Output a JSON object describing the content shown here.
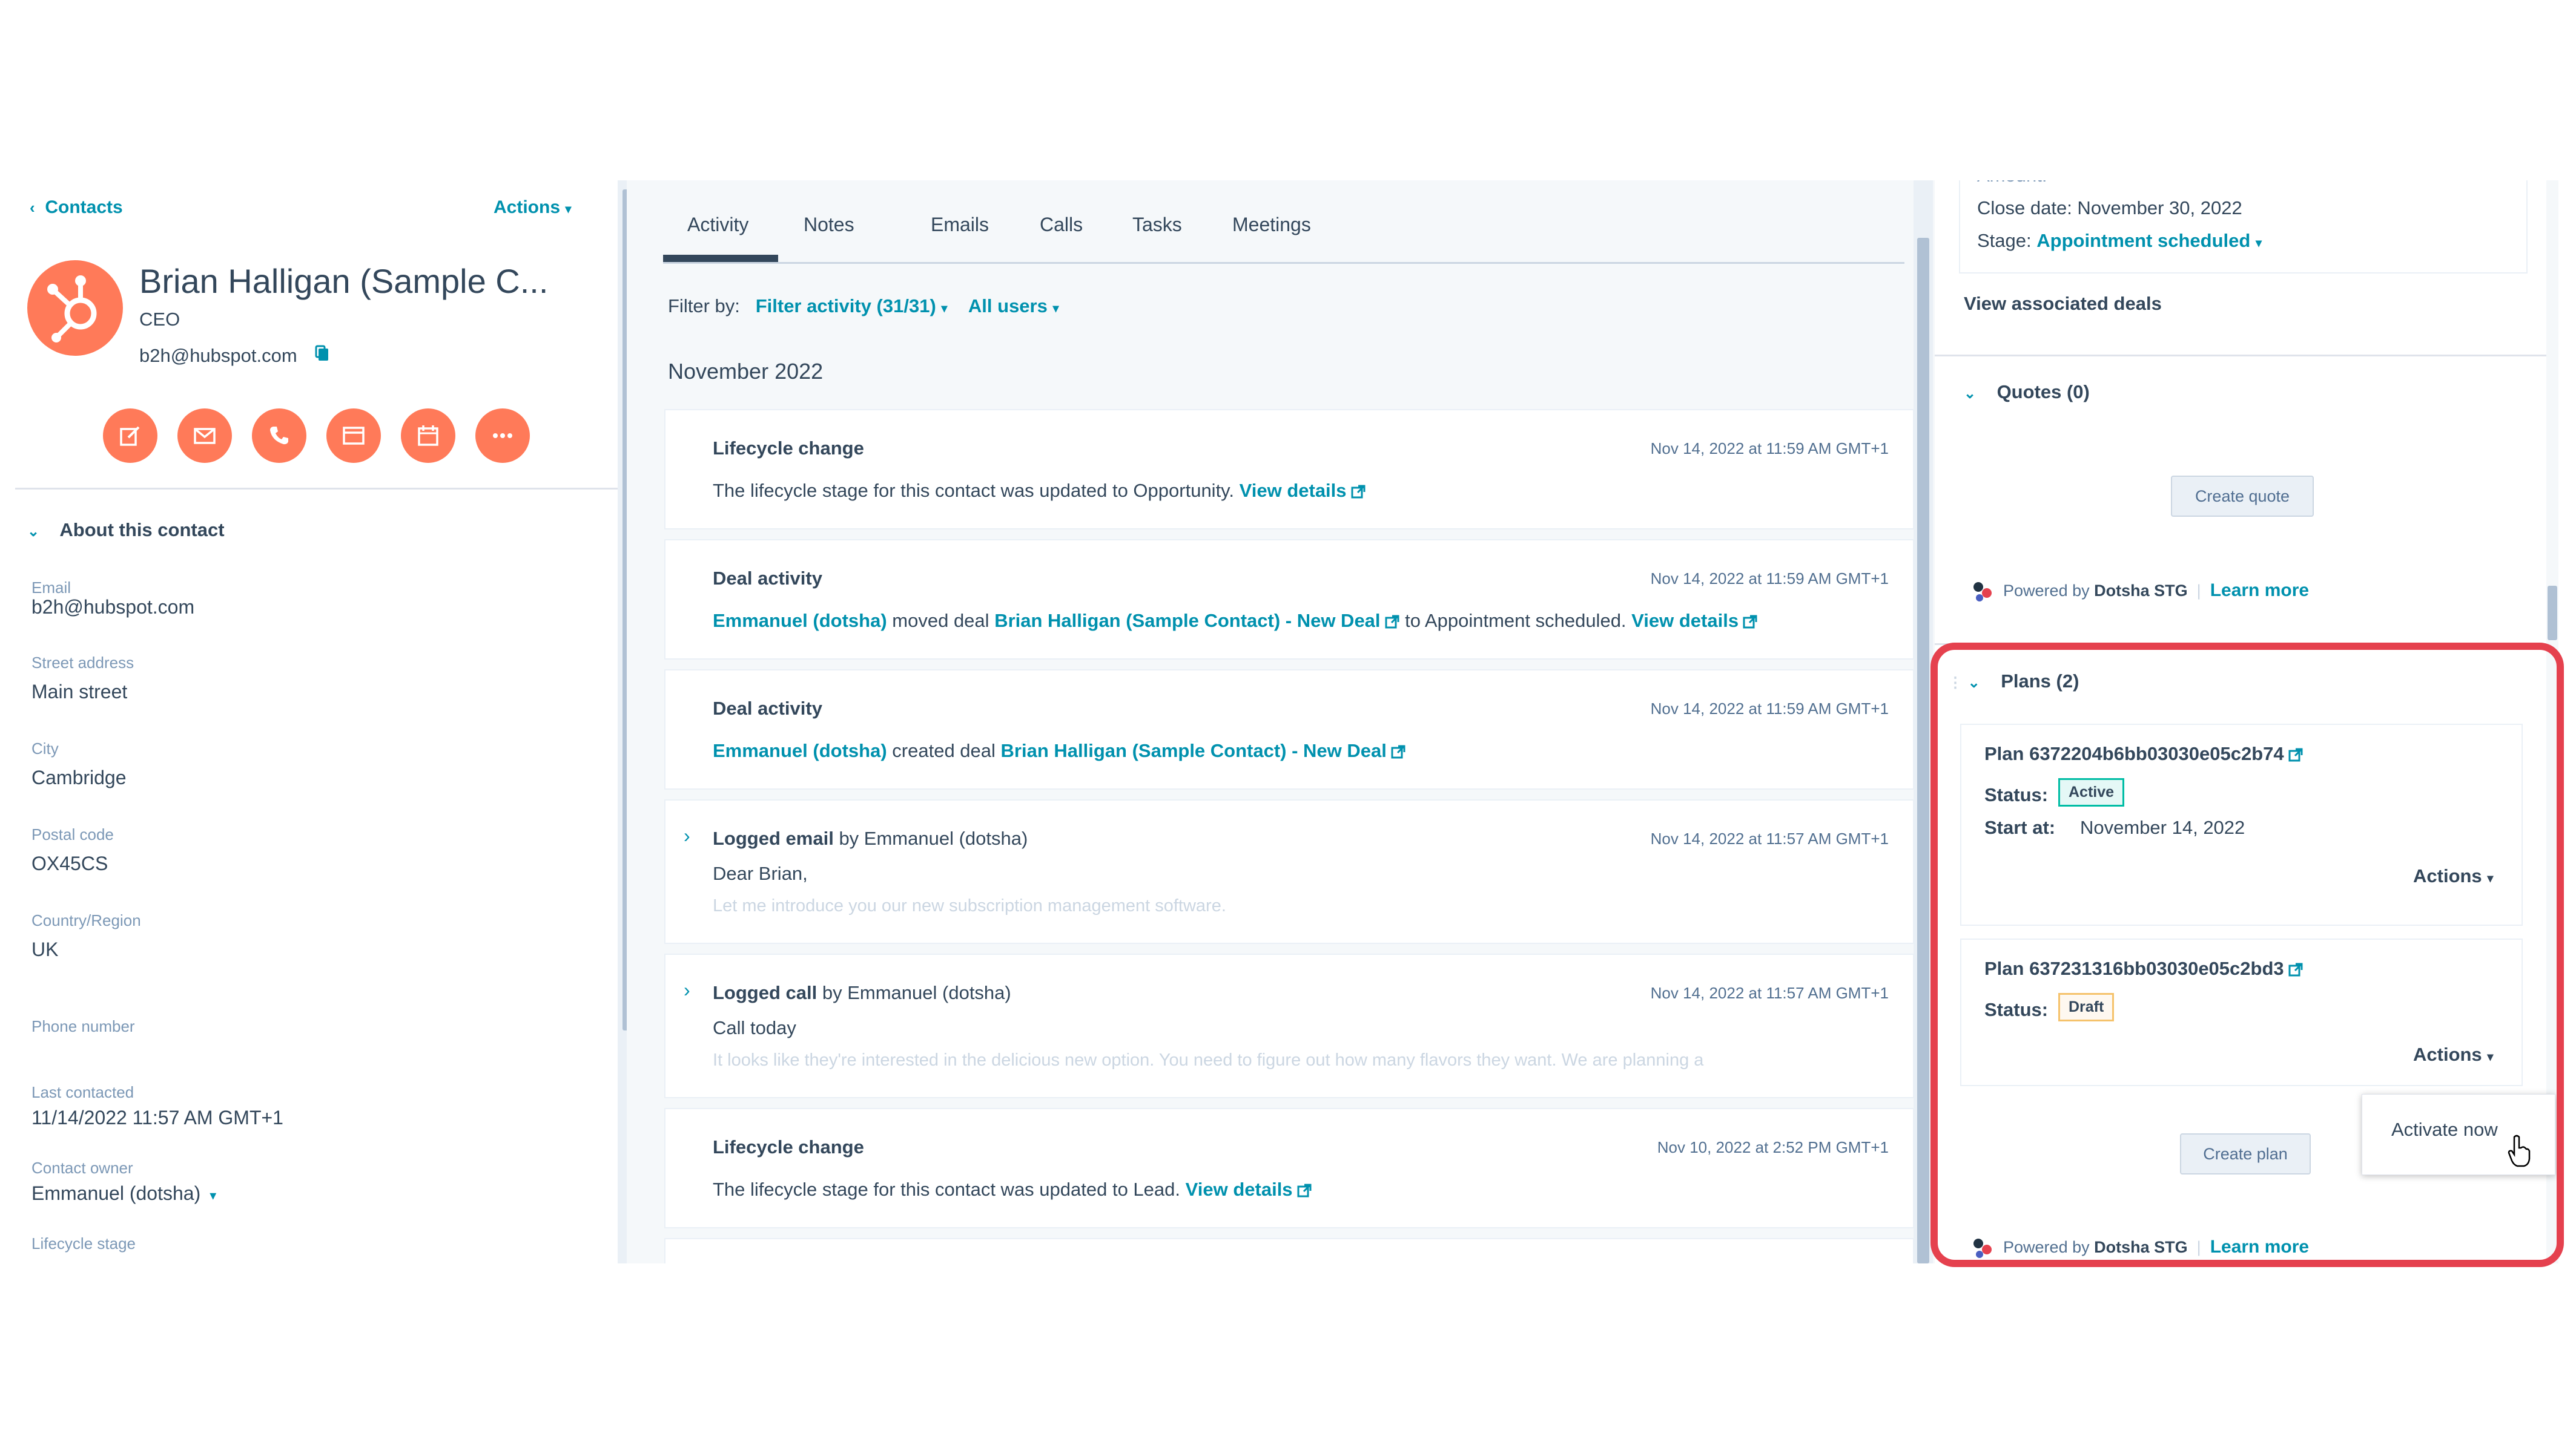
{
  "left": {
    "back_label": "Contacts",
    "actions_label": "Actions",
    "contact": {
      "name": "Brian Halligan (Sample C...",
      "title": "CEO",
      "email": "b2h@hubspot.com"
    },
    "about_header": "About this contact",
    "properties": [
      {
        "label": "Email",
        "value": "b2h@hubspot.com"
      },
      {
        "label": "Street address",
        "value": "Main street"
      },
      {
        "label": "City",
        "value": "Cambridge"
      },
      {
        "label": "Postal code",
        "value": "OX45CS"
      },
      {
        "label": "Country/Region",
        "value": "UK"
      },
      {
        "label": "Phone number",
        "value": ""
      },
      {
        "label": "Last contacted",
        "value": "11/14/2022 11:57 AM GMT+1"
      },
      {
        "label": "Contact owner",
        "value": "Emmanuel (dotsha)"
      },
      {
        "label": "Lifecycle stage",
        "value": ""
      }
    ]
  },
  "mid": {
    "tabs": [
      "Activity",
      "Notes",
      "Emails",
      "Calls",
      "Tasks",
      "Meetings"
    ],
    "filter_label": "Filter by:",
    "filter_activity": "Filter activity (31/31)",
    "filter_users": "All users",
    "month": "November 2022",
    "cards": [
      {
        "title": "Lifecycle change",
        "time": "Nov 14, 2022 at 11:59 AM GMT+1",
        "body_text": "The lifecycle stage for this contact was updated to Opportunity.",
        "link": "View details"
      },
      {
        "title": "Deal activity",
        "time": "Nov 14, 2022 at 11:59 AM GMT+1",
        "actor": "Emmanuel (dotsha)",
        "verb": "moved deal",
        "deal": "Brian Halligan (Sample Contact) - New Deal",
        "suffix": "to Appointment scheduled.",
        "link": "View details"
      },
      {
        "title": "Deal activity",
        "time": "Nov 14, 2022 at 11:59 AM GMT+1",
        "actor": "Emmanuel (dotsha)",
        "verb": "created deal",
        "deal": "Brian Halligan (Sample Contact) - New Deal"
      },
      {
        "title": "Logged email",
        "by": "by Emmanuel (dotsha)",
        "time": "Nov 14, 2022 at 11:57 AM GMT+1",
        "body_text": "Dear Brian,",
        "preview": "Let me introduce you our new subscription management software."
      },
      {
        "title": "Logged call",
        "by": "by Emmanuel (dotsha)",
        "time": "Nov 14, 2022 at 11:57 AM GMT+1",
        "body_text": "Call today",
        "preview": "It looks like they're interested in the delicious new option. You need to figure out how many flavors they want. We are planning a"
      },
      {
        "title": "Lifecycle change",
        "time": "Nov 10, 2022 at 2:52 PM GMT+1",
        "body_text": "The lifecycle stage for this contact was updated to Lead.",
        "link": "View details"
      }
    ]
  },
  "right": {
    "deal": {
      "amount": "Amount: --",
      "close_date": "Close date: November 30, 2022",
      "stage_label": "Stage:",
      "stage_value": "Appointment scheduled"
    },
    "view_deals": "View associated deals",
    "quotes_header": "Quotes (0)",
    "create_quote": "Create quote",
    "powered_prefix": "Powered by",
    "powered_brand": "Dotsha STG",
    "learn_more": "Learn more",
    "plans_header": "Plans (2)",
    "plans": [
      {
        "name": "Plan 6372204b6bb03030e05c2b74",
        "status_label": "Status:",
        "status": "Active",
        "start_label": "Start at:",
        "start": "November 14, 2022",
        "actions": "Actions"
      },
      {
        "name": "Plan 637231316bb03030e05c2bd3",
        "status_label": "Status:",
        "status": "Draft",
        "actions": "Actions"
      }
    ],
    "dropdown_item": "Activate now",
    "create_plan": "Create plan"
  },
  "colors": {
    "accent": "#0091ae",
    "brand_orange": "#ff7a59",
    "highlight": "#e5414e"
  }
}
